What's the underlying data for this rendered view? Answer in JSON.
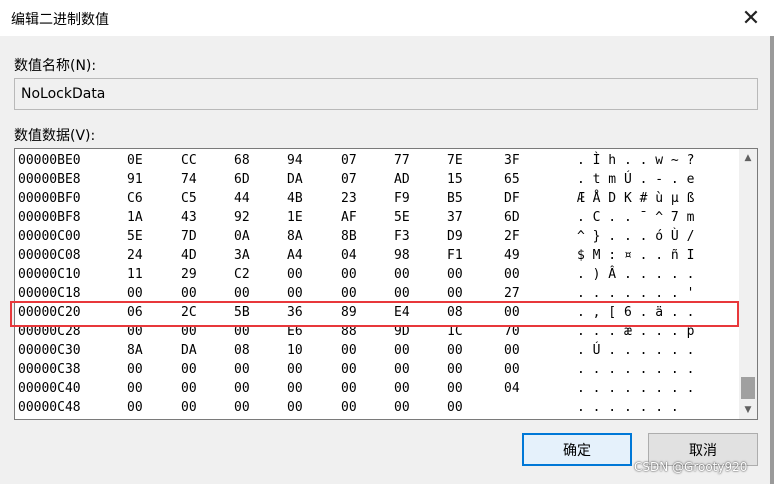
{
  "window": {
    "title": "编辑二进制数值",
    "close_symbol": "✕"
  },
  "name_label": "数值名称(N):",
  "name_value": "NoLockData",
  "data_label": "数值数据(V):",
  "hex_rows": [
    {
      "addr": "00000BE0",
      "bytes": [
        "0E",
        "CC",
        "68",
        "94",
        "07",
        "77",
        "7E",
        "3F"
      ],
      "ascii": ". Ì h . . w ~ ?"
    },
    {
      "addr": "00000BE8",
      "bytes": [
        "91",
        "74",
        "6D",
        "DA",
        "07",
        "AD",
        "15",
        "65"
      ],
      "ascii": ". t m Ú . - . e"
    },
    {
      "addr": "00000BF0",
      "bytes": [
        "C6",
        "C5",
        "44",
        "4B",
        "23",
        "F9",
        "B5",
        "DF"
      ],
      "ascii": "Æ Å D K # ù µ ß"
    },
    {
      "addr": "00000BF8",
      "bytes": [
        "1A",
        "43",
        "92",
        "1E",
        "AF",
        "5E",
        "37",
        "6D"
      ],
      "ascii": ". C . . ¯ ^ 7 m"
    },
    {
      "addr": "00000C00",
      "bytes": [
        "5E",
        "7D",
        "0A",
        "8A",
        "8B",
        "F3",
        "D9",
        "2F"
      ],
      "ascii": "^ } . . . ó Ù /"
    },
    {
      "addr": "00000C08",
      "bytes": [
        "24",
        "4D",
        "3A",
        "A4",
        "04",
        "98",
        "F1",
        "49"
      ],
      "ascii": "$ M : ¤ . . ñ I"
    },
    {
      "addr": "00000C10",
      "bytes": [
        "11",
        "29",
        "C2",
        "00",
        "00",
        "00",
        "00",
        "00"
      ],
      "ascii": ". ) Â . . . . ."
    },
    {
      "addr": "00000C18",
      "bytes": [
        "00",
        "00",
        "00",
        "00",
        "00",
        "00",
        "00",
        "27"
      ],
      "ascii": ". . . . . . . '"
    },
    {
      "addr": "00000C20",
      "bytes": [
        "06",
        "2C",
        "5B",
        "36",
        "89",
        "E4",
        "08",
        "00"
      ],
      "ascii": ". , [ 6 . ä . ."
    },
    {
      "addr": "00000C28",
      "bytes": [
        "00",
        "00",
        "00",
        "E6",
        "88",
        "9D",
        "1C",
        "70"
      ],
      "ascii": ". . . æ . . . p"
    },
    {
      "addr": "00000C30",
      "bytes": [
        "8A",
        "DA",
        "08",
        "10",
        "00",
        "00",
        "00",
        "00"
      ],
      "ascii": ". Ú . . . . . ."
    },
    {
      "addr": "00000C38",
      "bytes": [
        "00",
        "00",
        "00",
        "00",
        "00",
        "00",
        "00",
        "00"
      ],
      "ascii": ". . . . . . . ."
    },
    {
      "addr": "00000C40",
      "bytes": [
        "00",
        "00",
        "00",
        "00",
        "00",
        "00",
        "00",
        "04"
      ],
      "ascii": ". . . . . . . ."
    },
    {
      "addr": "00000C48",
      "bytes": [
        "00",
        "00",
        "00",
        "00",
        "00",
        "00",
        "00",
        ""
      ],
      "ascii": ". . . . . . ."
    }
  ],
  "highlighted_row_index": 8,
  "scroll_up_symbol": "▲",
  "scroll_down_symbol": "▼",
  "ok_label": "确定",
  "cancel_label": "取消",
  "watermark": "CSDN @Grooty920",
  "colors": {
    "highlight": "#e8383b",
    "focus": "#0078d7"
  }
}
